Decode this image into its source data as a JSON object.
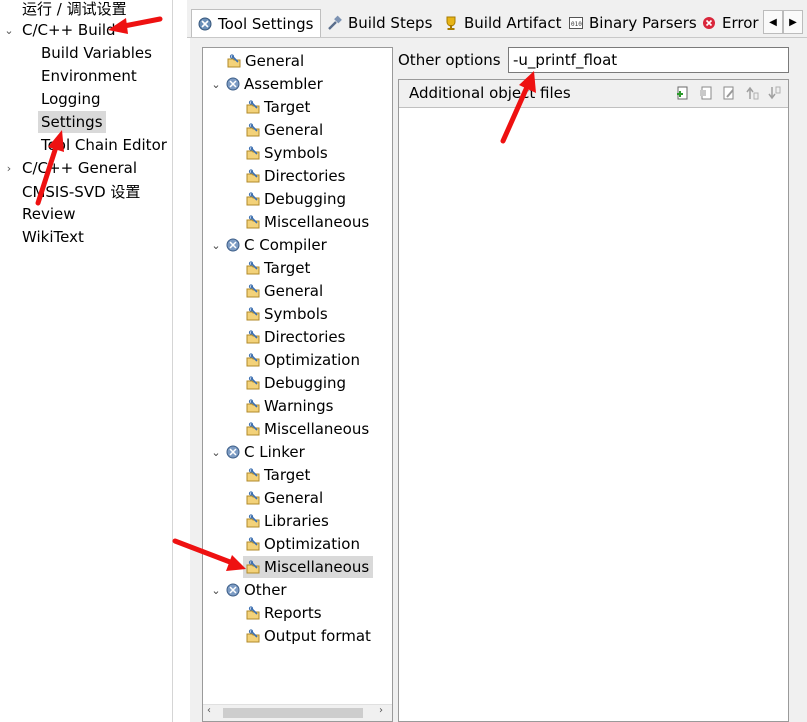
{
  "left_nav": {
    "items": [
      {
        "label": "运行 / 调试设置",
        "twisty": ""
      },
      {
        "label": "C/C++ Build",
        "twisty": "expanded"
      },
      {
        "label": "Build Variables",
        "twisty": ""
      },
      {
        "label": "Environment",
        "twisty": ""
      },
      {
        "label": "Logging",
        "twisty": ""
      },
      {
        "label": "Settings",
        "twisty": "",
        "selected": true
      },
      {
        "label": "Tool Chain Editor",
        "twisty": ""
      },
      {
        "label": "C/C++ General",
        "twisty": "collapsed"
      },
      {
        "label": "CMSIS-SVD 设置",
        "twisty": ""
      },
      {
        "label": "Review",
        "twisty": ""
      },
      {
        "label": "WikiText",
        "twisty": ""
      }
    ]
  },
  "tabs": [
    {
      "label": "Tool Settings",
      "active": true,
      "icon": "tool-settings-icon"
    },
    {
      "label": "Build Steps",
      "active": false,
      "icon": "build-steps-icon"
    },
    {
      "label": "Build Artifact",
      "active": false,
      "icon": "trophy-icon"
    },
    {
      "label": "Binary Parsers",
      "active": false,
      "icon": "binary-parser-icon"
    },
    {
      "label": "Error",
      "active": false,
      "icon": "error-icon"
    }
  ],
  "tool_tree": {
    "items": [
      {
        "label": "General",
        "level": 1,
        "icon": "option-page-icon"
      },
      {
        "label": "Assembler",
        "level": 0,
        "icon": "tool-icon",
        "expanded": true
      },
      {
        "label": "Target",
        "level": 1,
        "icon": "option-page-icon"
      },
      {
        "label": "General",
        "level": 1,
        "icon": "option-page-icon"
      },
      {
        "label": "Symbols",
        "level": 1,
        "icon": "option-page-icon"
      },
      {
        "label": "Directories",
        "level": 1,
        "icon": "option-page-icon"
      },
      {
        "label": "Debugging",
        "level": 1,
        "icon": "option-page-icon"
      },
      {
        "label": "Miscellaneous",
        "level": 1,
        "icon": "option-page-icon"
      },
      {
        "label": "C Compiler",
        "level": 0,
        "icon": "tool-icon",
        "expanded": true
      },
      {
        "label": "Target",
        "level": 1,
        "icon": "option-page-icon"
      },
      {
        "label": "General",
        "level": 1,
        "icon": "option-page-icon"
      },
      {
        "label": "Symbols",
        "level": 1,
        "icon": "option-page-icon"
      },
      {
        "label": "Directories",
        "level": 1,
        "icon": "option-page-icon"
      },
      {
        "label": "Optimization",
        "level": 1,
        "icon": "option-page-icon"
      },
      {
        "label": "Debugging",
        "level": 1,
        "icon": "option-page-icon"
      },
      {
        "label": "Warnings",
        "level": 1,
        "icon": "option-page-icon"
      },
      {
        "label": "Miscellaneous",
        "level": 1,
        "icon": "option-page-icon"
      },
      {
        "label": "C Linker",
        "level": 0,
        "icon": "tool-icon",
        "expanded": true
      },
      {
        "label": "Target",
        "level": 1,
        "icon": "option-page-icon"
      },
      {
        "label": "General",
        "level": 1,
        "icon": "option-page-icon"
      },
      {
        "label": "Libraries",
        "level": 1,
        "icon": "option-page-icon"
      },
      {
        "label": "Optimization",
        "level": 1,
        "icon": "option-page-icon"
      },
      {
        "label": "Miscellaneous",
        "level": 1,
        "icon": "option-page-icon",
        "selected": true
      },
      {
        "label": "Other",
        "level": 0,
        "icon": "tool-icon",
        "expanded": true
      },
      {
        "label": "Reports",
        "level": 1,
        "icon": "option-page-icon"
      },
      {
        "label": "Output format",
        "level": 1,
        "icon": "option-page-icon"
      }
    ]
  },
  "options": {
    "other_label": "Other options",
    "other_value": "-u_printf_float"
  },
  "objects": {
    "title": "Additional object files",
    "tools": [
      "add-icon",
      "add-workspace-icon",
      "edit-icon",
      "move-up-icon",
      "move-down-icon"
    ]
  },
  "colors": {
    "annotation_arrow": "#ee1111",
    "selection": "#d9d9d9",
    "panel_bg": "#f0f0f0"
  }
}
